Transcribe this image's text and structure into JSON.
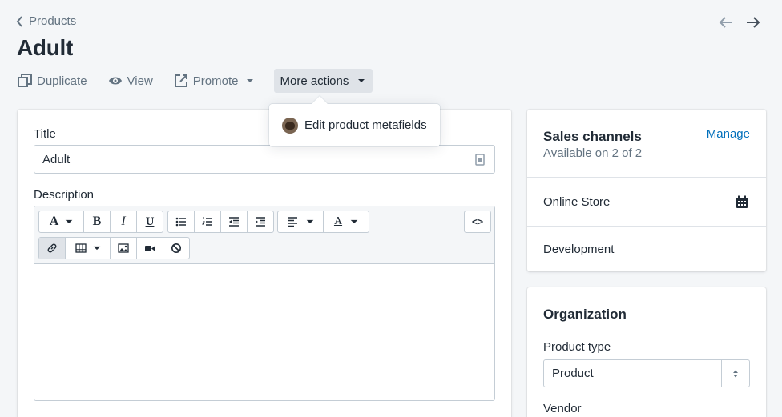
{
  "breadcrumb": {
    "label": "Products"
  },
  "page": {
    "title": "Adult"
  },
  "actions": {
    "duplicate": "Duplicate",
    "view": "View",
    "promote": "Promote",
    "more": "More actions"
  },
  "popover": {
    "item_label": "Edit product metafields"
  },
  "product_form": {
    "title_label": "Title",
    "title_value": "Adult",
    "description_label": "Description",
    "toolbar": {
      "font_glyph": "A",
      "bold_glyph": "B",
      "italic_glyph": "I",
      "underline_glyph": "U",
      "color_glyph": "A",
      "html_glyph": "<>"
    }
  },
  "sales_channels": {
    "title": "Sales channels",
    "manage_label": "Manage",
    "availability": "Available on 2 of 2",
    "channels": [
      "Online Store",
      "Development"
    ]
  },
  "organization": {
    "title": "Organization",
    "product_type_label": "Product type",
    "product_type_value": "Product",
    "vendor_label": "Vendor"
  },
  "colors": {
    "background": "#f4f6f8",
    "link": "#006fbb",
    "text": "#212b36",
    "subdued": "#637381",
    "border": "#c4cdd5"
  }
}
